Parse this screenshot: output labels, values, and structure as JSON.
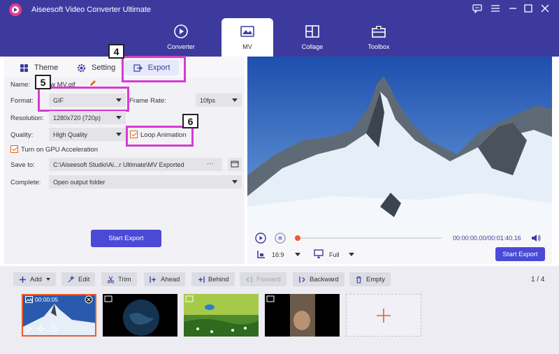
{
  "app": {
    "title": "Aiseesoft Video Converter Ultimate"
  },
  "nav": {
    "tabs": [
      {
        "label": "Converter",
        "icon": "converter-icon"
      },
      {
        "label": "MV",
        "icon": "mv-icon"
      },
      {
        "label": "Collage",
        "icon": "collage-icon"
      },
      {
        "label": "Toolbox",
        "icon": "toolbox-icon"
      }
    ]
  },
  "subtabs": {
    "theme": "Theme",
    "setting": "Setting",
    "export": "Export"
  },
  "annotations": {
    "export_step": "4",
    "format_step": "5",
    "loop_step": "6"
  },
  "form": {
    "name_label": "Name:",
    "name_value": "New MV.gif",
    "format_label": "Format:",
    "format_value": "GIF",
    "frame_rate_label": "Frame Rate:",
    "frame_rate_value": "10fps",
    "resolution_label": "Resolution:",
    "resolution_value": "1280x720 (720p)",
    "quality_label": "Quality:",
    "quality_value": "High Quality",
    "loop_label": "Loop Animation",
    "gpu_label": "Turn on GPU Acceleration",
    "save_to_label": "Save to:",
    "save_to_value": "C:\\Aiseesoft Studio\\Ai...r Ultimate\\MV Exported",
    "browse_label": "···",
    "complete_label": "Complete:",
    "complete_value": "Open output folder",
    "start_export_label": "Start Export"
  },
  "player": {
    "time_current": "00:00:00.00",
    "time_total": "00:01:40.16",
    "aspect": "16:9",
    "zoom": "Full",
    "start_export_label": "Start Export",
    "progress": 0
  },
  "toolbar": {
    "buttons": [
      "Add",
      "Edit",
      "Trim",
      "Ahead",
      "Behind",
      "Forward",
      "Backward",
      "Empty"
    ],
    "page_current": "1",
    "page_total": "4"
  },
  "clips": [
    {
      "duration": "00:00:05"
    }
  ],
  "colors": {
    "brand": "#3d3a9e",
    "accent": "#4a4ad6",
    "highlight": "#d63bd0",
    "progress": "#f05a2a"
  }
}
